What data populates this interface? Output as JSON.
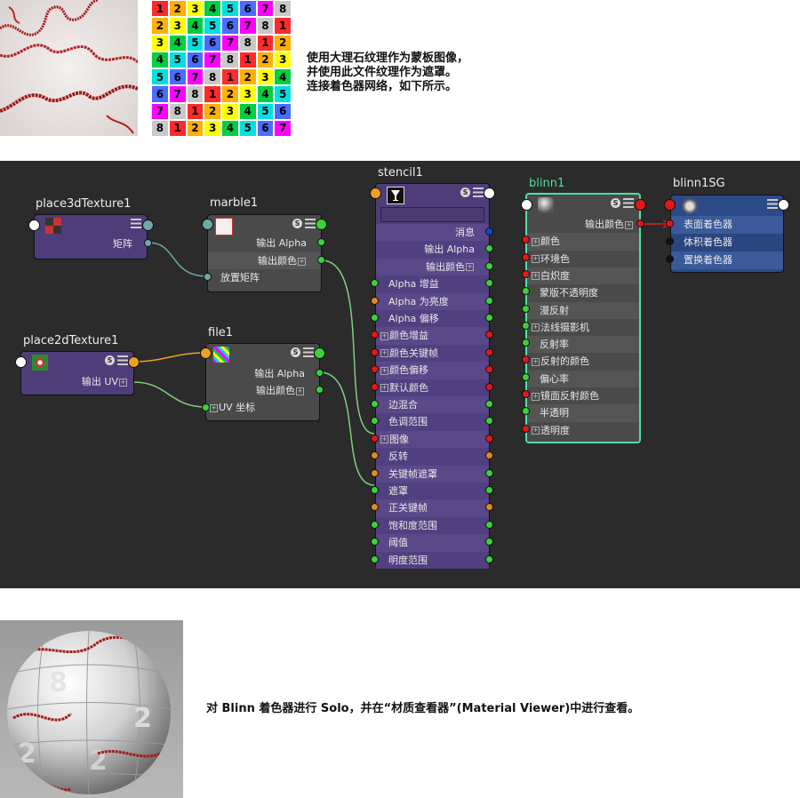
{
  "top_caption": {
    "line1": "使用大理石纹理作为蒙板图像，",
    "line2": "并使用此文件纹理作为遮罩。",
    "line3": "连接着色器网络，如下所示。"
  },
  "number_grid": {
    "rows": [
      [
        "1",
        "2",
        "3",
        "4",
        "5",
        "6",
        "7",
        "8"
      ],
      [
        "2",
        "3",
        "4",
        "5",
        "6",
        "7",
        "8",
        "1"
      ],
      [
        "3",
        "4",
        "5",
        "6",
        "7",
        "8",
        "1",
        "2"
      ],
      [
        "4",
        "5",
        "6",
        "7",
        "8",
        "1",
        "2",
        "3"
      ],
      [
        "5",
        "6",
        "7",
        "8",
        "1",
        "2",
        "3",
        "4"
      ],
      [
        "6",
        "7",
        "8",
        "1",
        "2",
        "3",
        "4",
        "5"
      ],
      [
        "7",
        "8",
        "1",
        "2",
        "3",
        "4",
        "5",
        "6"
      ],
      [
        "8",
        "1",
        "2",
        "3",
        "4",
        "5",
        "6",
        "7"
      ]
    ],
    "colors": {
      "1": "#ff2a2a",
      "2": "#ffb000",
      "3": "#ffff00",
      "4": "#00d040",
      "5": "#00e0e0",
      "6": "#4a6cff",
      "7": "#ff00ff",
      "8": "#c8c8c8"
    }
  },
  "nodes": {
    "place3d": {
      "title": "place3dTexture1",
      "out1": "矩阵"
    },
    "marble": {
      "title": "marble1",
      "out1": "输出 Alpha",
      "out2": "输出颜色",
      "in1": "放置矩阵"
    },
    "place2d": {
      "title": "place2dTexture1",
      "out1": "输出 UV"
    },
    "file": {
      "title": "file1",
      "out1": "输出 Alpha",
      "out2": "输出颜色",
      "in1": "UV 坐标"
    },
    "stencil": {
      "title": "stencil1",
      "rows": [
        "消息",
        "输出 Alpha",
        "输出颜色",
        "Alpha 增益",
        "Alpha 为亮度",
        "Alpha 偏移",
        "颜色增益",
        "颜色关键帧",
        "颜色偏移",
        "默认颜色",
        "边混合",
        "色调范围",
        "图像",
        "反转",
        "关键帧遮罩",
        "遮罩",
        "正关键帧",
        "饱和度范围",
        "阈值",
        "明度范围"
      ]
    },
    "blinn": {
      "title": "blinn1",
      "rows": [
        "输出颜色",
        "颜色",
        "环境色",
        "白炽度",
        "蒙版不透明度",
        "漫反射",
        "法线摄影机",
        "反射率",
        "反射的颜色",
        "偏心率",
        "镜面反射颜色",
        "半透明",
        "透明度"
      ]
    },
    "blinnsg": {
      "title": "blinn1SG",
      "rows": [
        "表面着色器",
        "体积着色器",
        "置换着色器"
      ]
    }
  },
  "bottom_caption": "对 Blinn 着色器进行 Solo，并在“材质查看器”(Material Viewer)中进行查看。",
  "colors": {
    "editor_bg": "#2b2b2b",
    "port_green": "#3ad23a",
    "port_red": "#e01818",
    "port_orange": "#e08a20",
    "port_blue": "#2244cc",
    "wire_green": "#7fd07f",
    "wire_teal": "#6fa8a8",
    "wire_orange": "#f0a020",
    "wire_red": "#e02020",
    "blinn_border": "#4fe0a0"
  }
}
